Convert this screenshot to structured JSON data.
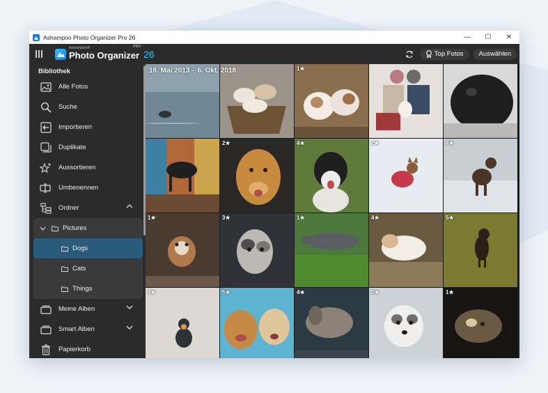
{
  "window": {
    "title": "Ashampoo Photo Organizer Pro 26",
    "controls": {
      "minimize": "—",
      "maximize": "☐",
      "close": "✕"
    }
  },
  "appbar": {
    "brand_small": "Ashampoo®",
    "brand_name": "Photo Organizer",
    "brand_pro": "PRO",
    "brand_version": "26",
    "top_photos_label": "Top Fotos",
    "select_label": "Auswählen",
    "accent_color": "#2ec3ff"
  },
  "sidebar": {
    "library_title": "Bibliothek",
    "items": [
      {
        "label": "Alle Fotos",
        "icon": "photo-icon"
      },
      {
        "label": "Suche",
        "icon": "search-icon"
      },
      {
        "label": "Importieren",
        "icon": "import-icon"
      },
      {
        "label": "Duplikate",
        "icon": "duplicates-icon"
      },
      {
        "label": "Aussortieren",
        "icon": "sparkle-icon"
      },
      {
        "label": "Umbenennen",
        "icon": "rename-icon"
      },
      {
        "label": "Ordner",
        "icon": "folder-tree-icon"
      }
    ],
    "folders": [
      {
        "label": "Pictures"
      },
      {
        "label": "Dogs"
      },
      {
        "label": "Cats"
      },
      {
        "label": "Things"
      }
    ],
    "bottom_items": [
      {
        "label": "Meine Alben",
        "icon": "album-icon"
      },
      {
        "label": "Smart Alben",
        "icon": "smart-album-icon"
      },
      {
        "label": "Papierkorb",
        "icon": "trash-icon"
      }
    ],
    "selected_color": "#2b5b7a"
  },
  "gallery": {
    "date_range": "16. Mai 2013 – 6. Okt. 2018",
    "ratings": {
      "r0c2": "1★",
      "r1c1": "2★",
      "r1c2": "4★",
      "r1c3": "2★",
      "r1c4": "4★",
      "r2c0": "1★",
      "r2c1": "3★",
      "r2c2": "1★",
      "r2c3": "4★",
      "r2c4": "5★",
      "r3c0": "4★",
      "r3c1": "5★",
      "r3c2": "4★",
      "r3c3": "2★",
      "r3c4": "1★"
    }
  }
}
